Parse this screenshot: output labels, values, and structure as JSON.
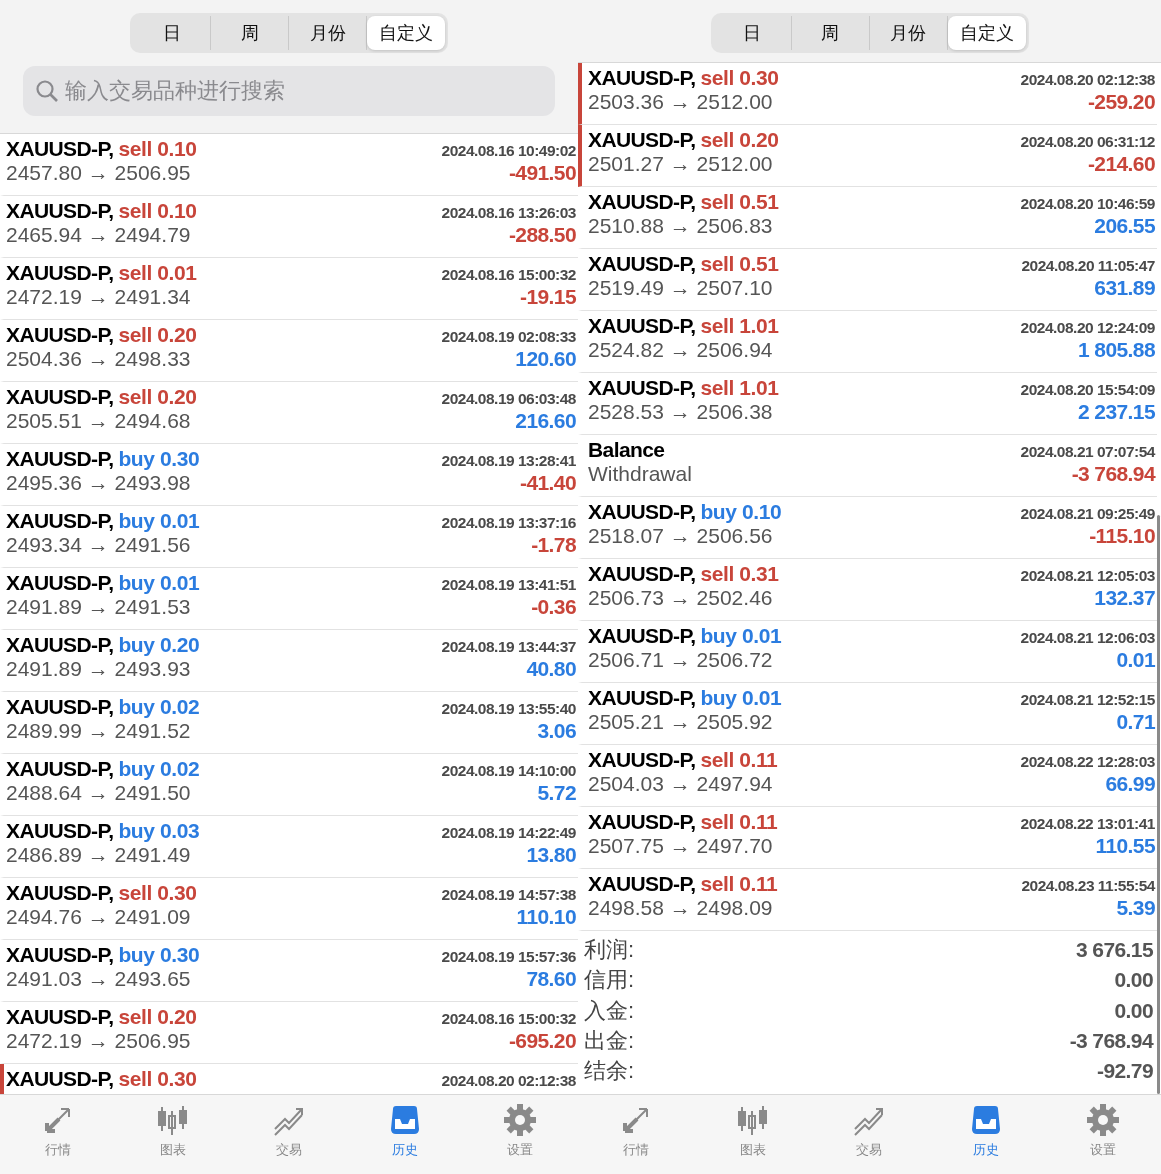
{
  "panels": [
    {
      "segments": [
        {
          "label": "日",
          "selected": false
        },
        {
          "label": "周",
          "selected": false
        },
        {
          "label": "月份",
          "selected": false
        },
        {
          "label": "自定义",
          "selected": true
        }
      ],
      "search": {
        "placeholder": "输入交易品种进行搜索"
      },
      "trades": [
        {
          "kind": "trade",
          "marked": false,
          "symbol": "XAUUSD-P,",
          "action": "sell 0.10",
          "color": "#c8453a",
          "time": "2024.08.16 10:49:02",
          "prices": "2457.80 → 2506.95",
          "pnl": {
            "value": "-491.50",
            "color": "#c8453a"
          }
        },
        {
          "kind": "trade",
          "marked": false,
          "symbol": "XAUUSD-P,",
          "action": "sell 0.10",
          "color": "#c8453a",
          "time": "2024.08.16 13:26:03",
          "prices": "2465.94 → 2494.79",
          "pnl": {
            "value": "-288.50",
            "color": "#c8453a"
          }
        },
        {
          "kind": "trade",
          "marked": false,
          "symbol": "XAUUSD-P,",
          "action": "sell 0.01",
          "color": "#c8453a",
          "time": "2024.08.16 15:00:32",
          "prices": "2472.19 → 2491.34",
          "pnl": {
            "value": "-19.15",
            "color": "#c8453a"
          }
        },
        {
          "kind": "trade",
          "marked": false,
          "symbol": "XAUUSD-P,",
          "action": "sell 0.20",
          "color": "#c8453a",
          "time": "2024.08.19 02:08:33",
          "prices": "2504.36 → 2498.33",
          "pnl": {
            "value": "120.60",
            "color": "#2b7ce0"
          }
        },
        {
          "kind": "trade",
          "marked": false,
          "symbol": "XAUUSD-P,",
          "action": "sell 0.20",
          "color": "#c8453a",
          "time": "2024.08.19 06:03:48",
          "prices": "2505.51 → 2494.68",
          "pnl": {
            "value": "216.60",
            "color": "#2b7ce0"
          }
        },
        {
          "kind": "trade",
          "marked": false,
          "symbol": "XAUUSD-P,",
          "action": "buy 0.30",
          "color": "#2b7ce0",
          "time": "2024.08.19 13:28:41",
          "prices": "2495.36 → 2493.98",
          "pnl": {
            "value": "-41.40",
            "color": "#c8453a"
          }
        },
        {
          "kind": "trade",
          "marked": false,
          "symbol": "XAUUSD-P,",
          "action": "buy 0.01",
          "color": "#2b7ce0",
          "time": "2024.08.19 13:37:16",
          "prices": "2493.34 → 2491.56",
          "pnl": {
            "value": "-1.78",
            "color": "#c8453a"
          }
        },
        {
          "kind": "trade",
          "marked": false,
          "symbol": "XAUUSD-P,",
          "action": "buy 0.01",
          "color": "#2b7ce0",
          "time": "2024.08.19 13:41:51",
          "prices": "2491.89 → 2491.53",
          "pnl": {
            "value": "-0.36",
            "color": "#c8453a"
          }
        },
        {
          "kind": "trade",
          "marked": false,
          "symbol": "XAUUSD-P,",
          "action": "buy 0.20",
          "color": "#2b7ce0",
          "time": "2024.08.19 13:44:37",
          "prices": "2491.89 → 2493.93",
          "pnl": {
            "value": "40.80",
            "color": "#2b7ce0"
          }
        },
        {
          "kind": "trade",
          "marked": false,
          "symbol": "XAUUSD-P,",
          "action": "buy 0.02",
          "color": "#2b7ce0",
          "time": "2024.08.19 13:55:40",
          "prices": "2489.99 → 2491.52",
          "pnl": {
            "value": "3.06",
            "color": "#2b7ce0"
          }
        },
        {
          "kind": "trade",
          "marked": false,
          "symbol": "XAUUSD-P,",
          "action": "buy 0.02",
          "color": "#2b7ce0",
          "time": "2024.08.19 14:10:00",
          "prices": "2488.64 → 2491.50",
          "pnl": {
            "value": "5.72",
            "color": "#2b7ce0"
          }
        },
        {
          "kind": "trade",
          "marked": false,
          "symbol": "XAUUSD-P,",
          "action": "buy 0.03",
          "color": "#2b7ce0",
          "time": "2024.08.19 14:22:49",
          "prices": "2486.89 → 2491.49",
          "pnl": {
            "value": "13.80",
            "color": "#2b7ce0"
          }
        },
        {
          "kind": "trade",
          "marked": false,
          "symbol": "XAUUSD-P,",
          "action": "sell 0.30",
          "color": "#c8453a",
          "time": "2024.08.19 14:57:38",
          "prices": "2494.76 → 2491.09",
          "pnl": {
            "value": "110.10",
            "color": "#2b7ce0"
          }
        },
        {
          "kind": "trade",
          "marked": false,
          "symbol": "XAUUSD-P,",
          "action": "buy 0.30",
          "color": "#2b7ce0",
          "time": "2024.08.19 15:57:36",
          "prices": "2491.03 → 2493.65",
          "pnl": {
            "value": "78.60",
            "color": "#2b7ce0"
          }
        },
        {
          "kind": "trade",
          "marked": false,
          "symbol": "XAUUSD-P,",
          "action": "sell 0.20",
          "color": "#c8453a",
          "time": "2024.08.16 15:00:32",
          "prices": "2472.19 → 2506.95",
          "pnl": {
            "value": "-695.20",
            "color": "#c8453a"
          }
        },
        {
          "kind": "trade",
          "marked": true,
          "symbol": "XAUUSD-P,",
          "action": "sell 0.30",
          "color": "#c8453a",
          "time": "2024.08.20 02:12:38"
        }
      ],
      "tabbar": [
        {
          "label": "行情",
          "selected": false
        },
        {
          "label": "图表",
          "selected": false
        },
        {
          "label": "交易",
          "selected": false
        },
        {
          "label": "历史",
          "selected": true
        },
        {
          "label": "设置",
          "selected": false
        }
      ]
    },
    {
      "segments": [
        {
          "label": "日",
          "selected": false
        },
        {
          "label": "周",
          "selected": false
        },
        {
          "label": "月份",
          "selected": false
        },
        {
          "label": "自定义",
          "selected": true
        }
      ],
      "trades": [
        {
          "kind": "trade",
          "marked": true,
          "symbol": "XAUUSD-P,",
          "action": "sell 0.30",
          "color": "#c8453a",
          "time": "2024.08.20 02:12:38",
          "prices": "2503.36 → 2512.00",
          "pnl": {
            "value": "-259.20",
            "color": "#c8453a"
          }
        },
        {
          "kind": "trade",
          "marked": true,
          "symbol": "XAUUSD-P,",
          "action": "sell 0.20",
          "color": "#c8453a",
          "time": "2024.08.20 06:31:12",
          "prices": "2501.27 → 2512.00",
          "pnl": {
            "value": "-214.60",
            "color": "#c8453a"
          }
        },
        {
          "kind": "trade",
          "marked": false,
          "symbol": "XAUUSD-P,",
          "action": "sell 0.51",
          "color": "#c8453a",
          "time": "2024.08.20 10:46:59",
          "prices": "2510.88 → 2506.83",
          "pnl": {
            "value": "206.55",
            "color": "#2b7ce0"
          }
        },
        {
          "kind": "trade",
          "marked": false,
          "symbol": "XAUUSD-P,",
          "action": "sell 0.51",
          "color": "#c8453a",
          "time": "2024.08.20 11:05:47",
          "prices": "2519.49 → 2507.10",
          "pnl": {
            "value": "631.89",
            "color": "#2b7ce0"
          }
        },
        {
          "kind": "trade",
          "marked": false,
          "symbol": "XAUUSD-P,",
          "action": "sell 1.01",
          "color": "#c8453a",
          "time": "2024.08.20 12:24:09",
          "prices": "2524.82 → 2506.94",
          "pnl": {
            "value": "1 805.88",
            "color": "#2b7ce0"
          }
        },
        {
          "kind": "trade",
          "marked": false,
          "symbol": "XAUUSD-P,",
          "action": "sell 1.01",
          "color": "#c8453a",
          "time": "2024.08.20 15:54:09",
          "prices": "2528.53 → 2506.38",
          "pnl": {
            "value": "2 237.15",
            "color": "#2b7ce0"
          }
        },
        {
          "kind": "balance",
          "marked": false,
          "symbol": "Balance",
          "time": "2024.08.21 07:07:54",
          "prices": "Withdrawal",
          "pnl": {
            "value": "-3 768.94",
            "color": "#c8453a"
          }
        },
        {
          "kind": "trade",
          "marked": false,
          "symbol": "XAUUSD-P,",
          "action": "buy 0.10",
          "color": "#2b7ce0",
          "time": "2024.08.21 09:25:49",
          "prices": "2518.07 → 2506.56",
          "pnl": {
            "value": "-115.10",
            "color": "#c8453a"
          }
        },
        {
          "kind": "trade",
          "marked": false,
          "symbol": "XAUUSD-P,",
          "action": "sell 0.31",
          "color": "#c8453a",
          "time": "2024.08.21 12:05:03",
          "prices": "2506.73 → 2502.46",
          "pnl": {
            "value": "132.37",
            "color": "#2b7ce0"
          }
        },
        {
          "kind": "trade",
          "marked": false,
          "symbol": "XAUUSD-P,",
          "action": "buy 0.01",
          "color": "#2b7ce0",
          "time": "2024.08.21 12:06:03",
          "prices": "2506.71 → 2506.72",
          "pnl": {
            "value": "0.01",
            "color": "#2b7ce0"
          }
        },
        {
          "kind": "trade",
          "marked": false,
          "symbol": "XAUUSD-P,",
          "action": "buy 0.01",
          "color": "#2b7ce0",
          "time": "2024.08.21 12:52:15",
          "prices": "2505.21 → 2505.92",
          "pnl": {
            "value": "0.71",
            "color": "#2b7ce0"
          }
        },
        {
          "kind": "trade",
          "marked": false,
          "symbol": "XAUUSD-P,",
          "action": "sell 0.11",
          "color": "#c8453a",
          "time": "2024.08.22 12:28:03",
          "prices": "2504.03 → 2497.94",
          "pnl": {
            "value": "66.99",
            "color": "#2b7ce0"
          }
        },
        {
          "kind": "trade",
          "marked": false,
          "symbol": "XAUUSD-P,",
          "action": "sell 0.11",
          "color": "#c8453a",
          "time": "2024.08.22 13:01:41",
          "prices": "2507.75 → 2497.70",
          "pnl": {
            "value": "110.55",
            "color": "#2b7ce0"
          }
        },
        {
          "kind": "trade",
          "marked": false,
          "symbol": "XAUUSD-P,",
          "action": "sell 0.11",
          "color": "#c8453a",
          "time": "2024.08.23 11:55:54",
          "prices": "2498.58 → 2498.09",
          "pnl": {
            "value": "5.39",
            "color": "#2b7ce0"
          }
        }
      ],
      "summary": [
        {
          "label": "利润:",
          "value": "3 676.15"
        },
        {
          "label": "信用:",
          "value": "0.00"
        },
        {
          "label": "入金:",
          "value": "0.00"
        },
        {
          "label": "出金:",
          "value": "-3 768.94"
        },
        {
          "label": "结余:",
          "value": "-92.79"
        }
      ],
      "tabbar": [
        {
          "label": "行情",
          "selected": false
        },
        {
          "label": "图表",
          "selected": false
        },
        {
          "label": "交易",
          "selected": false
        },
        {
          "label": "历史",
          "selected": true
        },
        {
          "label": "设置",
          "selected": false
        }
      ]
    }
  ]
}
